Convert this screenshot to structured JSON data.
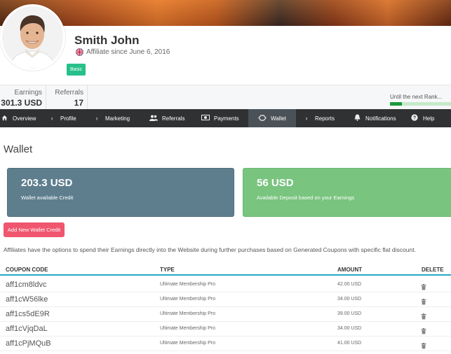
{
  "profile": {
    "name": "Smith John",
    "since": "Affiliate since June 6, 2016",
    "rank": "Basic"
  },
  "stats": {
    "earnings_label": "Earnings",
    "earnings_value": "301.3 USD",
    "referrals_label": "Referrals",
    "referrals_value": "17",
    "next_rank_label": "Until the next Rank...",
    "next_rank_progress": 0.2
  },
  "nav": [
    {
      "label": "Overview",
      "icon": "home-icon"
    },
    {
      "label": "Profile",
      "icon": "chevron-right-icon"
    },
    {
      "label": "Marketing",
      "icon": "chevron-right-icon"
    },
    {
      "label": "Referrals",
      "icon": "users-icon"
    },
    {
      "label": "Payments",
      "icon": "money-icon"
    },
    {
      "label": "Wallet",
      "icon": "wallet-icon",
      "active": true
    },
    {
      "label": "Reports",
      "icon": "chevron-right-icon"
    },
    {
      "label": "Notifications",
      "icon": "bell-icon"
    },
    {
      "label": "Help",
      "icon": "question-icon"
    }
  ],
  "wallet": {
    "title": "Wallet",
    "credit_amount": "203.3 USD",
    "credit_label": "Wallet available Credit",
    "deposit_amount": "56 USD",
    "deposit_label": "Available Deposit based on your Earnings",
    "add_button": "Add New Wallet Credit",
    "info": "Affiliates have the options to spend their Earnings directly into the Website during further purchases based on Generated Coupons with specific flat discount."
  },
  "table": {
    "headers": [
      "COUPON CODE",
      "TYPE",
      "AMOUNT",
      "DELETE"
    ],
    "rows": [
      {
        "code": "aff1cm8ldvc",
        "type": "Ultimate Membership Pro",
        "amount": "42.00 USD"
      },
      {
        "code": "aff1cW56lke",
        "type": "Ultimate Membership Pro",
        "amount": "34.00 USD"
      },
      {
        "code": "aff1cs5dE9R",
        "type": "Ultimate Membership Pro",
        "amount": "39.00 USD"
      },
      {
        "code": "aff1cVjqDaL",
        "type": "Ultimate Membership Pro",
        "amount": "34.00 USD"
      },
      {
        "code": "aff1cPjMQuB",
        "type": "Ultimate Membership Pro",
        "amount": "41.00 USD"
      }
    ]
  },
  "colors": {
    "accent": "#2aa8c4",
    "nav_bg": "#2f3133",
    "credit_card": "#5e7e8e",
    "deposit_card": "#79c47f",
    "add_button": "#f0566e",
    "rank_badge": "#27c08a"
  }
}
